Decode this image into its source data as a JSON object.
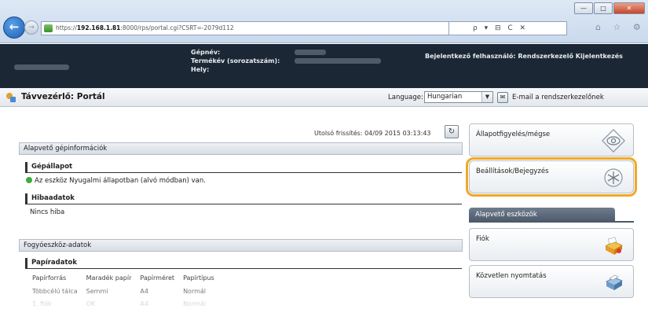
{
  "browser": {
    "url_prefix": "https://",
    "url_host": "192.168.1.81",
    "url_path": ":8000/rps/portal.cgi?CSRT=-2079d112",
    "search_tools": "ρ ▾ ⊟ C ✕",
    "window_buttons": [
      "—",
      "□",
      "✕"
    ],
    "tab_icons": "⌂ ☆ ⚙"
  },
  "device_header": {
    "labels": [
      "Gépnév:",
      "Termékév (sorozatszám):",
      "Hely:"
    ],
    "login_label": "Bejelentkező felhasználó: Rendszerkezelő Kijelentkezés"
  },
  "titlebar": {
    "title": "Távvezérlő: Portál",
    "language_label": "Language:",
    "language_value": "Hungarian",
    "mail_link": "E-mail a rendszerkezelőnek"
  },
  "main": {
    "last_update": "Utolsó frissítés: 04/09 2015 03:13:43",
    "sections": {
      "basic_info": "Alapvető gépinformációk",
      "consumables": "Fogyóeszköz-adatok"
    },
    "machine_status": {
      "heading": "Gépállapot",
      "text": "Az eszköz Nyugalmi állapotban (alvó módban) van."
    },
    "errors": {
      "heading": "Hibaadatok",
      "text": "Nincs hiba"
    },
    "paper": {
      "heading": "Papíradatok",
      "columns": [
        "Papírforrás",
        "Maradék papír",
        "Papírméret",
        "Papírtípus"
      ],
      "rows": [
        [
          "Többcélú tálca",
          "Semmi",
          "A4",
          "Normál"
        ],
        [
          "1. fiók",
          "OK",
          "A4",
          "Normál"
        ]
      ]
    }
  },
  "sidebar": {
    "status_button": "Állapotfigyelés/mégse",
    "settings_button": "Beállítások/Bejegyzés",
    "tools_tab": "Alapvető eszközök",
    "mailbox_button": "Fiók",
    "direct_print_button": "Közvetlen nyomtatás"
  }
}
